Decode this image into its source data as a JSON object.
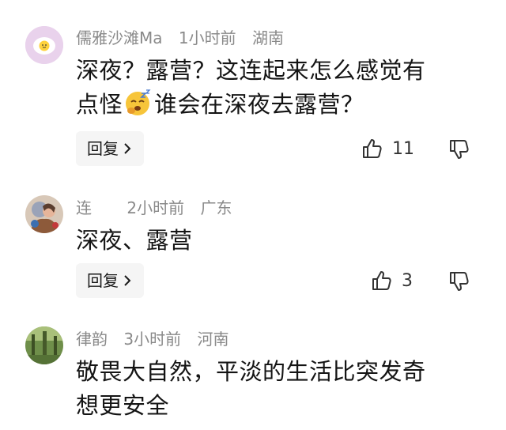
{
  "comments": [
    {
      "username": "儒雅沙滩Ma",
      "time": "1小时前",
      "location": "湖南",
      "text_line1": "深夜？露营？这连起来怎么感觉有",
      "text_line2a": "点怪",
      "text_emoji": "sleepy-face-emoji",
      "text_line2b": "谁会在深夜去露营？",
      "reply_label": "回复",
      "likes": "11"
    },
    {
      "username": "连",
      "time": "2小时前",
      "location": "广东",
      "text_line1": "深夜、露营",
      "reply_label": "回复",
      "likes": "3"
    },
    {
      "username": "律韵",
      "time": "3小时前",
      "location": "河南",
      "text_line1": "敬畏大自然，平淡的生活比突发奇",
      "text_line2a": "想更安全"
    }
  ],
  "icons": {
    "like": "thumbs-up-icon",
    "dislike": "thumbs-down-icon",
    "chevron": "chevron-right-icon"
  },
  "colors": {
    "meta_text": "#8a8a8a",
    "reply_bg": "#f5f5f5"
  }
}
